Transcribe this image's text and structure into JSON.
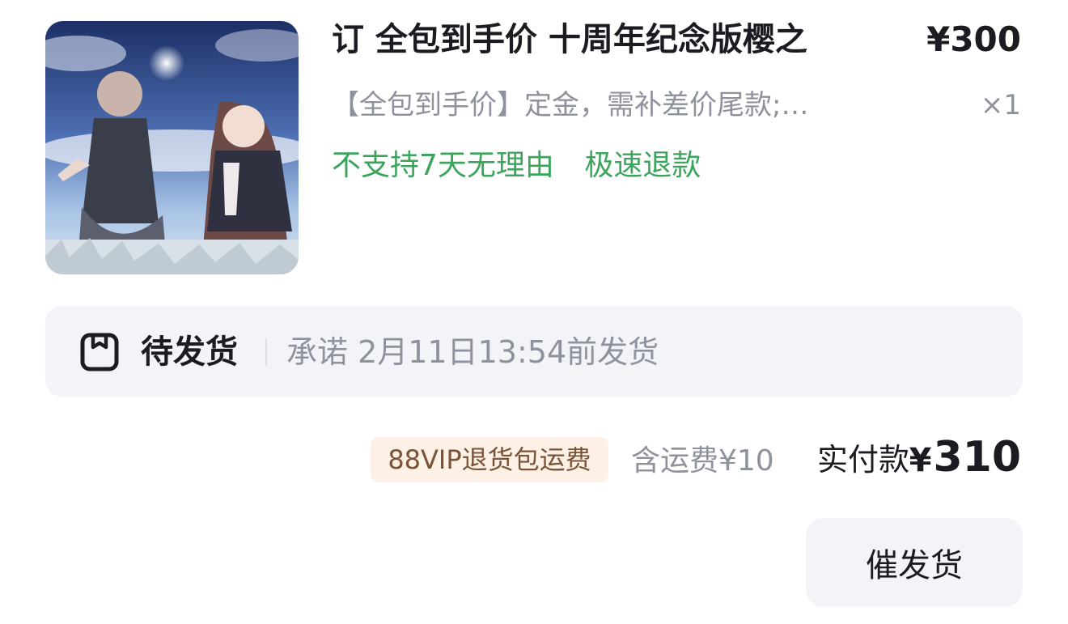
{
  "order": {
    "product": {
      "title": "订 全包到手价 十周年纪念版樱之",
      "price": "¥300",
      "sku": "【全包到手价】定金，需补差价尾款;…",
      "quantity": "×1",
      "service_tags": [
        "不支持7天无理由",
        "极速退款"
      ]
    },
    "status": {
      "icon": "package-icon",
      "label": "待发货",
      "promise": "承诺 2月11日13:54前发货"
    },
    "payment": {
      "vip_badge": "88VIP退货包运费",
      "shipping": "含运费¥10",
      "paid_label": "实付款",
      "currency_symbol": "¥",
      "paid_amount": "310"
    },
    "actions": {
      "urge_shipping_label": "催发货"
    }
  },
  "colors": {
    "text_primary": "#1b1c22",
    "text_secondary": "#8e929c",
    "service_green": "#3ba55c",
    "status_bg": "#f3f4f7",
    "vip_bg": "#fdf1e6",
    "vip_text": "#7a5238"
  }
}
